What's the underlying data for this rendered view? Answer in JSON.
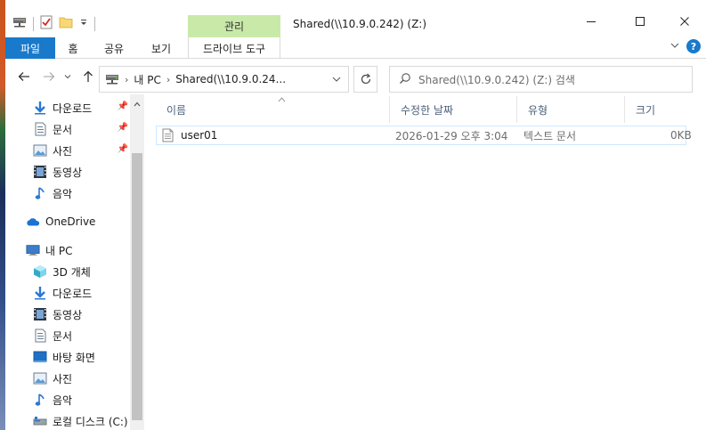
{
  "window": {
    "title": "Shared(\\\\10.9.0.242) (Z:)",
    "contextual_tab_group": "관리"
  },
  "ribbon": {
    "tabs": [
      "파일",
      "홈",
      "공유",
      "보기"
    ],
    "contextual_tab": "드라이브 도구"
  },
  "navbar": {
    "address": [
      "내 PC",
      "Shared(\\\\10.9.0.24..."
    ],
    "search_placeholder": "Shared(\\\\10.9.0.242) (Z:) 검색"
  },
  "navpane": {
    "quick_access": [
      {
        "label": "다운로드",
        "icon": "download-icon",
        "pinned": true
      },
      {
        "label": "문서",
        "icon": "document-icon",
        "pinned": true
      },
      {
        "label": "사진",
        "icon": "pictures-icon",
        "pinned": true
      },
      {
        "label": "동영상",
        "icon": "video-icon",
        "pinned": false
      },
      {
        "label": "음악",
        "icon": "music-icon",
        "pinned": false
      }
    ],
    "onedrive": "OneDrive",
    "this_pc": "내 PC",
    "this_pc_items": [
      {
        "label": "3D 개체",
        "icon": "3d-objects-icon"
      },
      {
        "label": "다운로드",
        "icon": "download-icon"
      },
      {
        "label": "동영상",
        "icon": "video-icon"
      },
      {
        "label": "문서",
        "icon": "document-icon"
      },
      {
        "label": "바탕 화면",
        "icon": "desktop-icon"
      },
      {
        "label": "사진",
        "icon": "pictures-icon"
      },
      {
        "label": "음악",
        "icon": "music-icon"
      },
      {
        "label": "로컬 디스크 (C:)",
        "icon": "local-disk-icon"
      }
    ]
  },
  "filelist": {
    "columns": [
      "이름",
      "수정한 날짜",
      "유형",
      "크기"
    ],
    "rows": [
      {
        "name": "user01",
        "modified": "2026-01-29 오후 3:04",
        "type": "텍스트 문서",
        "size": "0KB"
      }
    ]
  },
  "colors": {
    "accent": "#1979ca",
    "contextual_tab": "#c9e9a8",
    "selection_border": "#cde8ff"
  }
}
